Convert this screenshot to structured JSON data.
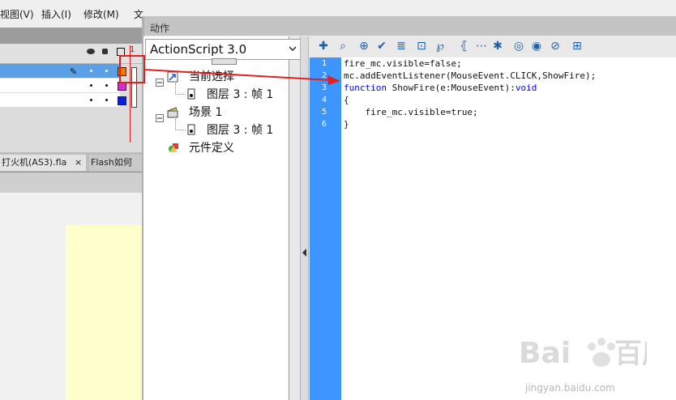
{
  "menubar": {
    "items": [
      "视图(V)",
      "插入(I)",
      "修改(M)",
      "文"
    ]
  },
  "timeline": {
    "header_icons": [
      "eye-icon",
      "lock-icon",
      "outline-icon"
    ],
    "frame_number": "1",
    "layers": [
      {
        "color": "#f07800"
      },
      {
        "color": "#cc33cc"
      },
      {
        "color": "#0b1fd6"
      }
    ]
  },
  "doc_tabs": [
    {
      "label": "打火机(AS3).fla",
      "close": "×"
    },
    {
      "label": "Flash如何"
    }
  ],
  "actions_panel": {
    "title": "动作",
    "language_select": "ActionScript 3.0",
    "tree": [
      {
        "label": "当前选择",
        "icon": "current-selection-icon"
      },
      {
        "label": "图层 3 : 帧 1",
        "icon": "frame-icon"
      },
      {
        "label": "场景 1",
        "icon": "scene-icon"
      },
      {
        "label": "图层 3 : 帧 1",
        "icon": "frame-icon"
      },
      {
        "label": "元件定义",
        "icon": "symbol-definitions-icon"
      }
    ],
    "toolbar_icons": [
      "add-statement-icon",
      "find-icon",
      "target-icon",
      "check-syntax-icon",
      "auto-format-icon",
      "code-hint-icon",
      "debug-options-icon",
      "collapse-braces-icon",
      "collapse-selection-icon",
      "expand-all-icon",
      "apply-block-comment-icon",
      "apply-line-comment-icon",
      "remove-comment-icon",
      "show-hide-toolbox-icon"
    ],
    "line_numbers": [
      "1",
      "2",
      "3",
      "4",
      "5",
      "6"
    ],
    "code_lines": [
      "fire_mc.visible=false;",
      "mc.addEventListener(MouseEvent.CLICK,ShowFire);",
      "function ShowFire(e:MouseEvent):void",
      "{",
      "    fire_mc.visible=true;",
      "}"
    ],
    "code_keywords": {
      "line3_kw": "function",
      "line3_rest": " ShowFire(e:MouseEvent):",
      "line3_void": "void"
    }
  },
  "watermark": {
    "text": "jingyan.baidu.com"
  },
  "colors": {
    "gutter": "#3d95ff",
    "annotation_red": "#e02020",
    "stage": "#ffffcc"
  }
}
